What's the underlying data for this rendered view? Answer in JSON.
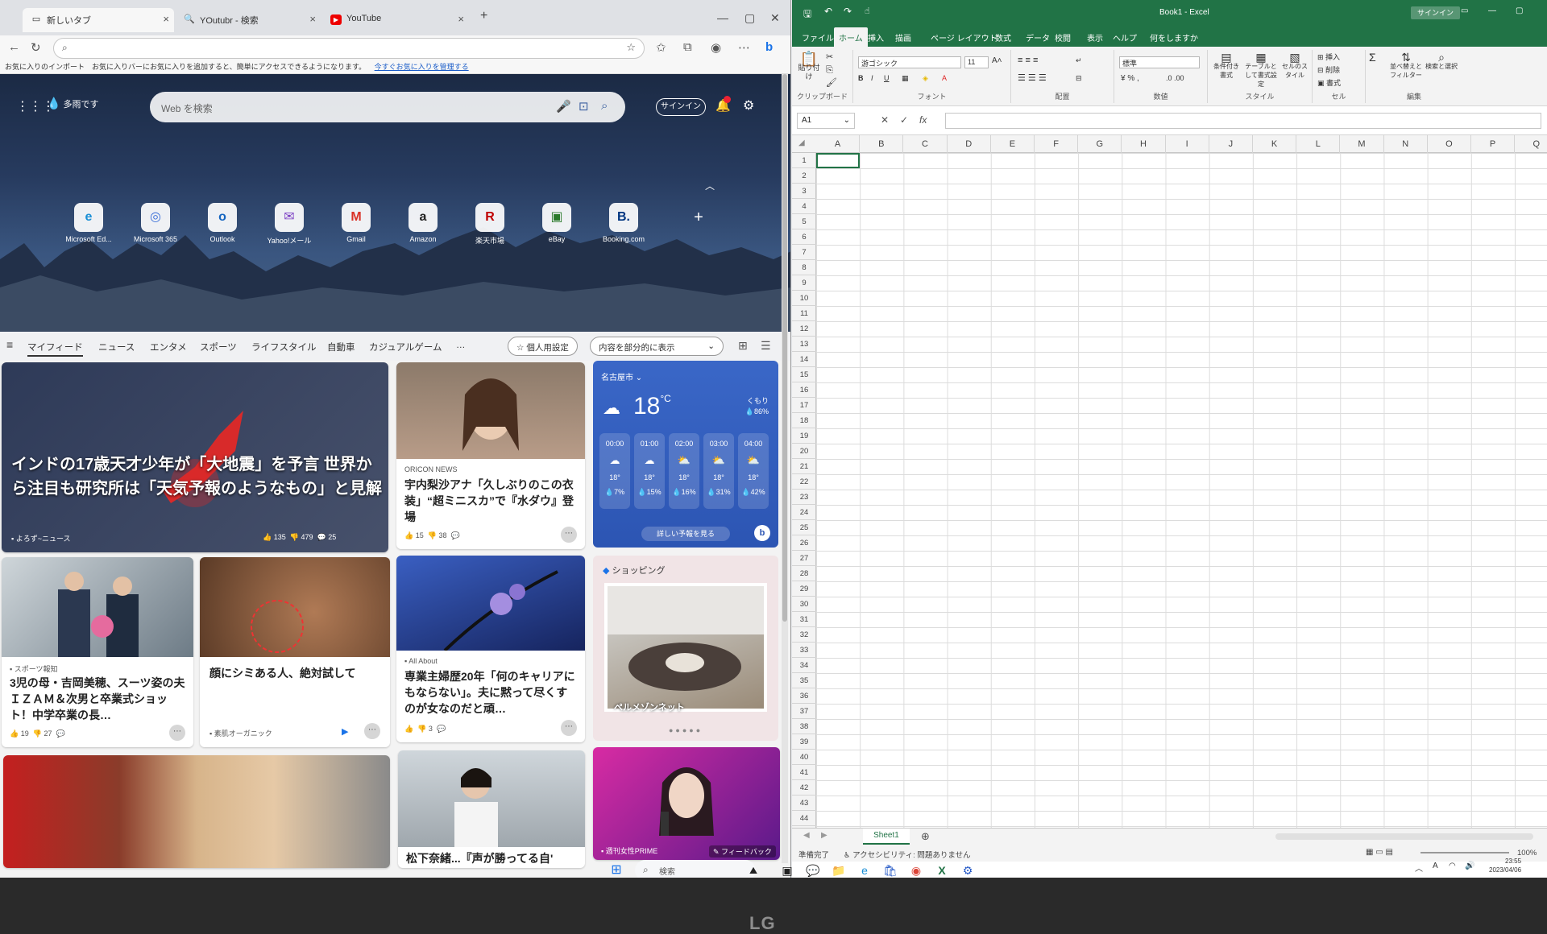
{
  "browser": {
    "tabs": [
      {
        "label": "新しいタブ",
        "icon": "tab-page-icon"
      },
      {
        "label": "YOutubr - 検索",
        "icon": "search-icon"
      },
      {
        "label": "YouTube",
        "icon": "youtube-icon"
      }
    ],
    "favbar_text": "お気に入りのインポート　お気に入りバーにお気に入りを追加すると、簡単にアクセスできるようになります。",
    "favbar_link": "今すぐお気に入りを管理する",
    "weather_mini": "多雨です",
    "search_placeholder": "Web を検索",
    "signin": "サインイン",
    "quick_links": [
      {
        "label": "Microsoft Ed...",
        "glyph": "e",
        "color": "#1a8fd6"
      },
      {
        "label": "Microsoft 365",
        "glyph": "◎",
        "color": "#3a6fd8"
      },
      {
        "label": "Outlook",
        "glyph": "o",
        "color": "#1565c0"
      },
      {
        "label": "Yahoo!メール",
        "glyph": "✉",
        "color": "#7b3fc4"
      },
      {
        "label": "Gmail",
        "glyph": "M",
        "color": "#d93025"
      },
      {
        "label": "Amazon",
        "glyph": "a",
        "color": "#222222"
      },
      {
        "label": "楽天市場",
        "glyph": "R",
        "color": "#bf0000"
      },
      {
        "label": "eBay",
        "glyph": "▣",
        "color": "#2a7a2a"
      },
      {
        "label": "Booking.com",
        "glyph": "B.",
        "color": "#003580"
      }
    ],
    "feed_nav": [
      "マイフィード",
      "ニュース",
      "エンタメ",
      "スポーツ",
      "ライフスタイル",
      "自動車",
      "カジュアルゲーム",
      "…"
    ],
    "personalize": "個人用設定",
    "display_mode": "内容を部分的に表示",
    "cards": {
      "main": {
        "title": "インドの17歳天才少年が「大地震」を予言 世界から注目も研究所は「天気予報のようなもの」と見解",
        "source": "よろず~ニュース",
        "likes": "135",
        "dislikes": "479",
        "comments": "25"
      },
      "oricon": {
        "source": "ORICON NEWS",
        "title": "宇内梨沙アナ「久しぶりのこの衣装」“超ミニスカ”で『水ダウ』登場",
        "likes": "15",
        "dislikes": "38"
      },
      "sports": {
        "source": "スポーツ報知",
        "title": "3児の母・吉岡美穂、スーツ姿の夫ＩＺＡＭ＆次男と卒業式ショット！中学卒業の長…",
        "likes": "19",
        "dislikes": "27"
      },
      "ad": {
        "title": "顔にシミある人、絶対試して",
        "source": "素肌オーガニック"
      },
      "allabout": {
        "source": "All About",
        "title": "専業主婦歴20年「何のキャリアにもならない」。夫に黙って尽くすのが女なのだと頑…",
        "dislikes": "3"
      },
      "bottom_mid": {
        "title": "松下奈緒...『声が勝ってる自'"
      },
      "bottom_right": {
        "source": "週刊女性PRIME",
        "feedback": "フィードバック"
      }
    },
    "weather": {
      "location": "名古屋市",
      "temp": "18",
      "unit": "°C",
      "condition": "くもり",
      "rain": "86%",
      "hours": [
        {
          "time": "00:00",
          "temp": "18°",
          "rain": "7%"
        },
        {
          "time": "01:00",
          "temp": "18°",
          "rain": "15%"
        },
        {
          "time": "02:00",
          "temp": "18°",
          "rain": "16%"
        },
        {
          "time": "03:00",
          "temp": "18°",
          "rain": "31%"
        },
        {
          "time": "04:00",
          "temp": "18°",
          "rain": "42%"
        }
      ],
      "detail_button": "詳しい予報を見る"
    },
    "shopping": {
      "header": "ショッピング",
      "label": "ペルメゾンネット"
    }
  },
  "excel": {
    "title": "Book1 - Excel",
    "signin": "サインイン",
    "menu": [
      "ファイル",
      "ホーム",
      "挿入",
      "描画",
      "ページ レイアウト",
      "数式",
      "データ",
      "校閲",
      "表示",
      "ヘルプ",
      "何をしますか"
    ],
    "ribbon_groups": [
      "クリップボード",
      "フォント",
      "配置",
      "数値",
      "スタイル",
      "セル",
      "編集"
    ],
    "paste": "貼り付け",
    "font_name": "游ゴシック",
    "font_size": "11",
    "number_format": "標準",
    "conditional": "条件付き書式",
    "table_format": "テーブルとして書式設定",
    "cell_styles": "セルのスタイル",
    "insert": "挿入",
    "delete": "削除",
    "format": "書式",
    "sort_filter": "並べ替えとフィルター",
    "find_select": "検索と選択",
    "name_box": "A1",
    "columns": [
      "A",
      "B",
      "C",
      "D",
      "E",
      "F",
      "G",
      "H",
      "I",
      "J",
      "K",
      "L",
      "M",
      "N",
      "O",
      "P",
      "Q"
    ],
    "rows": [
      "1",
      "2",
      "3",
      "4",
      "5",
      "6",
      "7",
      "8",
      "9",
      "10",
      "11",
      "12",
      "13",
      "14",
      "15",
      "16",
      "17",
      "18",
      "19",
      "20",
      "21",
      "22",
      "23",
      "24",
      "25",
      "26",
      "27",
      "28",
      "29",
      "30",
      "31",
      "32",
      "33",
      "34",
      "35",
      "36",
      "37",
      "38",
      "39",
      "40",
      "41",
      "42",
      "43",
      "44"
    ],
    "sheet": "Sheet1",
    "status_ready": "準備完了",
    "status_access": "アクセシビリティ: 問題ありません",
    "zoom": "100%"
  },
  "taskbar": {
    "search": "検索",
    "time": "23:55",
    "date": "2023/04/06"
  },
  "monitor": {
    "brand": "LG"
  }
}
